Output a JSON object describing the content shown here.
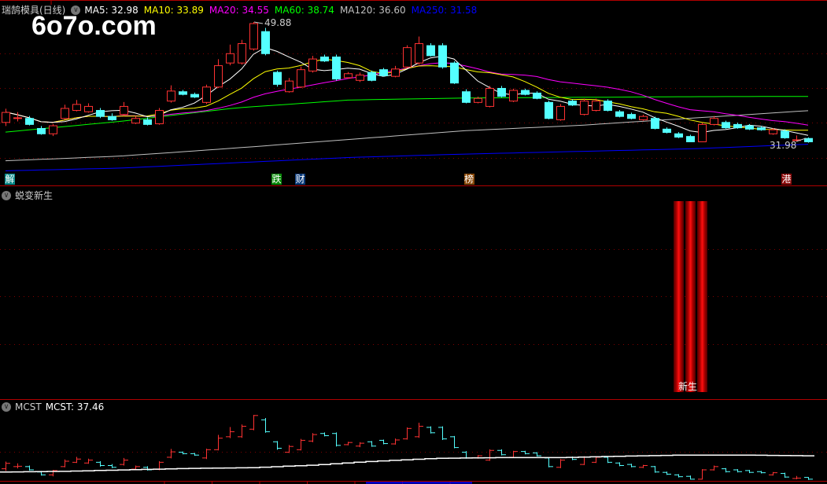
{
  "header": {
    "title": "瑞鹄模具(日线)",
    "ma": [
      {
        "label": "MA5: 32.98",
        "color": "#ffffff"
      },
      {
        "label": "MA10: 33.89",
        "color": "#ffff00"
      },
      {
        "label": "MA20: 34.55",
        "color": "#ff00ff"
      },
      {
        "label": "MA60: 38.74",
        "color": "#00ff00"
      },
      {
        "label": "MA120: 36.60",
        "color": "#c0c0c0"
      },
      {
        "label": "MA250: 31.58",
        "color": "#0000ff"
      }
    ]
  },
  "watermark": "6o7o.com",
  "high_label": "49.88",
  "low_label": "31.98",
  "events": [
    {
      "text": "解",
      "index": 0,
      "color": "#0a8a8a"
    },
    {
      "text": "跌",
      "index": 22.6,
      "color": "#0a8a0a"
    },
    {
      "text": "财",
      "index": 24.6,
      "color": "#0a3a7a"
    },
    {
      "text": "榜",
      "index": 38.9,
      "color": "#8a4a0a"
    },
    {
      "text": "港",
      "index": 65.8,
      "color": "#8a0a0a"
    }
  ],
  "indicator": {
    "title": "蜕变新生",
    "signal_label": "新生",
    "signal_indices": [
      57,
      58,
      59
    ]
  },
  "mcst": {
    "title": "MCST",
    "value_label": "MCST: 37.46",
    "anchors": [
      34.0,
      34.2,
      34.6,
      35.0,
      35.2,
      35.9,
      37.0,
      37.8,
      38.0,
      38.0,
      38.4,
      38.7,
      38.7,
      38.5
    ],
    "mcst_color": "#ffffff"
  },
  "colors": {
    "up": "#ff3232",
    "down": "#54ffff",
    "grid": "#800000",
    "border": "#b00000"
  },
  "chart_data": {
    "type": "candlestick",
    "ohlc": [
      [
        34.9,
        36.4,
        36.9,
        34.3
      ],
      [
        35.5,
        35.6,
        36.4,
        35.0
      ],
      [
        35.5,
        34.6,
        35.8,
        34.4
      ],
      [
        34.0,
        33.2,
        34.3,
        33.0
      ],
      [
        33.2,
        34.4,
        34.6,
        32.8
      ],
      [
        35.5,
        37.0,
        37.5,
        35.3
      ],
      [
        36.7,
        37.6,
        38.2,
        36.5
      ],
      [
        36.5,
        37.3,
        37.7,
        36.3
      ],
      [
        36.7,
        35.8,
        37.0,
        35.5
      ],
      [
        35.8,
        35.3,
        36.2,
        35.1
      ],
      [
        36.1,
        37.3,
        37.9,
        35.8
      ],
      [
        34.8,
        35.5,
        35.8,
        34.6
      ],
      [
        35.3,
        34.6,
        35.6,
        34.4
      ],
      [
        34.7,
        36.7,
        37.0,
        34.5
      ],
      [
        38.1,
        39.6,
        40.4,
        37.8
      ],
      [
        39.5,
        39.1,
        39.7,
        38.9
      ],
      [
        39.1,
        38.7,
        39.3,
        38.5
      ],
      [
        37.9,
        40.2,
        40.5,
        37.6
      ],
      [
        40.2,
        43.4,
        44.3,
        40.0
      ],
      [
        43.8,
        45.2,
        46.5,
        43.4
      ],
      [
        43.8,
        46.7,
        47.2,
        43.5
      ],
      [
        45.9,
        49.7,
        49.88,
        45.6
      ],
      [
        48.5,
        45.2,
        49.0,
        44.9
      ],
      [
        42.4,
        40.6,
        42.6,
        40.2
      ],
      [
        39.5,
        41.1,
        41.5,
        39.3
      ],
      [
        40.2,
        42.8,
        43.2,
        40.0
      ],
      [
        42.6,
        44.4,
        44.8,
        42.3
      ],
      [
        44.7,
        44.1,
        45.0,
        43.9
      ],
      [
        44.7,
        41.4,
        45.0,
        41.1
      ],
      [
        41.6,
        42.2,
        42.4,
        41.4
      ],
      [
        41.2,
        42.0,
        42.3,
        40.9
      ],
      [
        42.4,
        41.2,
        42.6,
        41.0
      ],
      [
        42.8,
        41.9,
        43.0,
        41.7
      ],
      [
        41.8,
        42.9,
        43.3,
        41.6
      ],
      [
        43.2,
        46.1,
        46.4,
        43.0
      ],
      [
        43.8,
        46.7,
        47.7,
        43.5
      ],
      [
        46.4,
        44.9,
        46.7,
        44.7
      ],
      [
        46.4,
        43.2,
        46.7,
        42.9
      ],
      [
        43.8,
        40.8,
        44.0,
        40.6
      ],
      [
        39.5,
        37.9,
        39.8,
        37.7
      ],
      [
        37.9,
        38.5,
        38.7,
        37.7
      ],
      [
        37.3,
        40.0,
        40.3,
        37.1
      ],
      [
        40.0,
        38.8,
        40.3,
        38.6
      ],
      [
        38.1,
        39.7,
        39.9,
        37.9
      ],
      [
        39.7,
        39.1,
        39.9,
        38.9
      ],
      [
        39.3,
        38.5,
        39.5,
        38.3
      ],
      [
        37.9,
        35.5,
        38.1,
        35.3
      ],
      [
        35.3,
        37.3,
        37.6,
        35.1
      ],
      [
        38.1,
        37.5,
        38.3,
        37.3
      ],
      [
        36.1,
        38.1,
        38.4,
        35.9
      ],
      [
        36.7,
        38.1,
        38.4,
        36.5
      ],
      [
        38.1,
        36.7,
        38.3,
        36.5
      ],
      [
        36.5,
        35.8,
        36.7,
        35.6
      ],
      [
        36.1,
        35.5,
        36.3,
        35.3
      ],
      [
        35.3,
        35.8,
        36.0,
        35.1
      ],
      [
        35.5,
        34.0,
        35.7,
        33.8
      ],
      [
        33.9,
        33.4,
        34.1,
        33.2
      ],
      [
        33.2,
        32.7,
        33.4,
        32.5
      ],
      [
        32.8,
        32.0,
        33.0,
        31.98
      ],
      [
        32.0,
        34.6,
        34.8,
        31.9
      ],
      [
        34.6,
        35.5,
        35.8,
        34.4
      ],
      [
        34.9,
        34.1,
        35.1,
        33.9
      ],
      [
        34.6,
        34.1,
        34.8,
        33.9
      ],
      [
        34.4,
        33.9,
        34.6,
        33.7
      ],
      [
        34.1,
        33.8,
        34.3,
        33.6
      ],
      [
        33.2,
        33.8,
        34.0,
        33.0
      ],
      [
        33.6,
        32.6,
        33.8,
        32.4
      ],
      [
        32.2,
        32.3,
        32.9,
        31.98
      ],
      [
        32.5,
        32.0,
        32.6,
        31.8
      ]
    ],
    "ma_long": {
      "MA60": [
        33.4,
        35.0,
        37.0,
        38.2,
        38.5,
        38.6,
        38.7,
        38.74
      ],
      "MA120": [
        29.1,
        29.8,
        31.0,
        32.3,
        33.6,
        34.4,
        35.5,
        36.6
      ],
      "MA250": [
        27.6,
        28.0,
        28.8,
        29.6,
        30.1,
        30.5,
        30.9,
        31.58
      ]
    }
  }
}
